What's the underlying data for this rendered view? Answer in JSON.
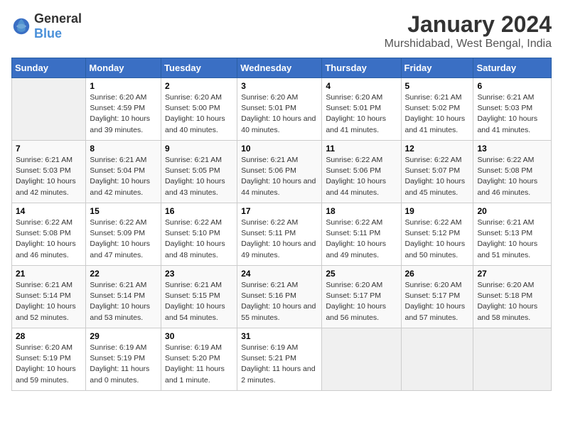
{
  "logo": {
    "general": "General",
    "blue": "Blue"
  },
  "title": "January 2024",
  "subtitle": "Murshidabad, West Bengal, India",
  "days_of_week": [
    "Sunday",
    "Monday",
    "Tuesday",
    "Wednesday",
    "Thursday",
    "Friday",
    "Saturday"
  ],
  "weeks": [
    [
      {
        "day": "",
        "sunrise": "",
        "sunset": "",
        "daylight": ""
      },
      {
        "day": "1",
        "sunrise": "Sunrise: 6:20 AM",
        "sunset": "Sunset: 4:59 PM",
        "daylight": "Daylight: 10 hours and 39 minutes."
      },
      {
        "day": "2",
        "sunrise": "Sunrise: 6:20 AM",
        "sunset": "Sunset: 5:00 PM",
        "daylight": "Daylight: 10 hours and 40 minutes."
      },
      {
        "day": "3",
        "sunrise": "Sunrise: 6:20 AM",
        "sunset": "Sunset: 5:01 PM",
        "daylight": "Daylight: 10 hours and 40 minutes."
      },
      {
        "day": "4",
        "sunrise": "Sunrise: 6:20 AM",
        "sunset": "Sunset: 5:01 PM",
        "daylight": "Daylight: 10 hours and 41 minutes."
      },
      {
        "day": "5",
        "sunrise": "Sunrise: 6:21 AM",
        "sunset": "Sunset: 5:02 PM",
        "daylight": "Daylight: 10 hours and 41 minutes."
      },
      {
        "day": "6",
        "sunrise": "Sunrise: 6:21 AM",
        "sunset": "Sunset: 5:03 PM",
        "daylight": "Daylight: 10 hours and 41 minutes."
      }
    ],
    [
      {
        "day": "7",
        "sunrise": "Sunrise: 6:21 AM",
        "sunset": "Sunset: 5:03 PM",
        "daylight": "Daylight: 10 hours and 42 minutes."
      },
      {
        "day": "8",
        "sunrise": "Sunrise: 6:21 AM",
        "sunset": "Sunset: 5:04 PM",
        "daylight": "Daylight: 10 hours and 42 minutes."
      },
      {
        "day": "9",
        "sunrise": "Sunrise: 6:21 AM",
        "sunset": "Sunset: 5:05 PM",
        "daylight": "Daylight: 10 hours and 43 minutes."
      },
      {
        "day": "10",
        "sunrise": "Sunrise: 6:21 AM",
        "sunset": "Sunset: 5:06 PM",
        "daylight": "Daylight: 10 hours and 44 minutes."
      },
      {
        "day": "11",
        "sunrise": "Sunrise: 6:22 AM",
        "sunset": "Sunset: 5:06 PM",
        "daylight": "Daylight: 10 hours and 44 minutes."
      },
      {
        "day": "12",
        "sunrise": "Sunrise: 6:22 AM",
        "sunset": "Sunset: 5:07 PM",
        "daylight": "Daylight: 10 hours and 45 minutes."
      },
      {
        "day": "13",
        "sunrise": "Sunrise: 6:22 AM",
        "sunset": "Sunset: 5:08 PM",
        "daylight": "Daylight: 10 hours and 46 minutes."
      }
    ],
    [
      {
        "day": "14",
        "sunrise": "Sunrise: 6:22 AM",
        "sunset": "Sunset: 5:08 PM",
        "daylight": "Daylight: 10 hours and 46 minutes."
      },
      {
        "day": "15",
        "sunrise": "Sunrise: 6:22 AM",
        "sunset": "Sunset: 5:09 PM",
        "daylight": "Daylight: 10 hours and 47 minutes."
      },
      {
        "day": "16",
        "sunrise": "Sunrise: 6:22 AM",
        "sunset": "Sunset: 5:10 PM",
        "daylight": "Daylight: 10 hours and 48 minutes."
      },
      {
        "day": "17",
        "sunrise": "Sunrise: 6:22 AM",
        "sunset": "Sunset: 5:11 PM",
        "daylight": "Daylight: 10 hours and 49 minutes."
      },
      {
        "day": "18",
        "sunrise": "Sunrise: 6:22 AM",
        "sunset": "Sunset: 5:11 PM",
        "daylight": "Daylight: 10 hours and 49 minutes."
      },
      {
        "day": "19",
        "sunrise": "Sunrise: 6:22 AM",
        "sunset": "Sunset: 5:12 PM",
        "daylight": "Daylight: 10 hours and 50 minutes."
      },
      {
        "day": "20",
        "sunrise": "Sunrise: 6:21 AM",
        "sunset": "Sunset: 5:13 PM",
        "daylight": "Daylight: 10 hours and 51 minutes."
      }
    ],
    [
      {
        "day": "21",
        "sunrise": "Sunrise: 6:21 AM",
        "sunset": "Sunset: 5:14 PM",
        "daylight": "Daylight: 10 hours and 52 minutes."
      },
      {
        "day": "22",
        "sunrise": "Sunrise: 6:21 AM",
        "sunset": "Sunset: 5:14 PM",
        "daylight": "Daylight: 10 hours and 53 minutes."
      },
      {
        "day": "23",
        "sunrise": "Sunrise: 6:21 AM",
        "sunset": "Sunset: 5:15 PM",
        "daylight": "Daylight: 10 hours and 54 minutes."
      },
      {
        "day": "24",
        "sunrise": "Sunrise: 6:21 AM",
        "sunset": "Sunset: 5:16 PM",
        "daylight": "Daylight: 10 hours and 55 minutes."
      },
      {
        "day": "25",
        "sunrise": "Sunrise: 6:20 AM",
        "sunset": "Sunset: 5:17 PM",
        "daylight": "Daylight: 10 hours and 56 minutes."
      },
      {
        "day": "26",
        "sunrise": "Sunrise: 6:20 AM",
        "sunset": "Sunset: 5:17 PM",
        "daylight": "Daylight: 10 hours and 57 minutes."
      },
      {
        "day": "27",
        "sunrise": "Sunrise: 6:20 AM",
        "sunset": "Sunset: 5:18 PM",
        "daylight": "Daylight: 10 hours and 58 minutes."
      }
    ],
    [
      {
        "day": "28",
        "sunrise": "Sunrise: 6:20 AM",
        "sunset": "Sunset: 5:19 PM",
        "daylight": "Daylight: 10 hours and 59 minutes."
      },
      {
        "day": "29",
        "sunrise": "Sunrise: 6:19 AM",
        "sunset": "Sunset: 5:19 PM",
        "daylight": "Daylight: 11 hours and 0 minutes."
      },
      {
        "day": "30",
        "sunrise": "Sunrise: 6:19 AM",
        "sunset": "Sunset: 5:20 PM",
        "daylight": "Daylight: 11 hours and 1 minute."
      },
      {
        "day": "31",
        "sunrise": "Sunrise: 6:19 AM",
        "sunset": "Sunset: 5:21 PM",
        "daylight": "Daylight: 11 hours and 2 minutes."
      },
      {
        "day": "",
        "sunrise": "",
        "sunset": "",
        "daylight": ""
      },
      {
        "day": "",
        "sunrise": "",
        "sunset": "",
        "daylight": ""
      },
      {
        "day": "",
        "sunrise": "",
        "sunset": "",
        "daylight": ""
      }
    ]
  ]
}
